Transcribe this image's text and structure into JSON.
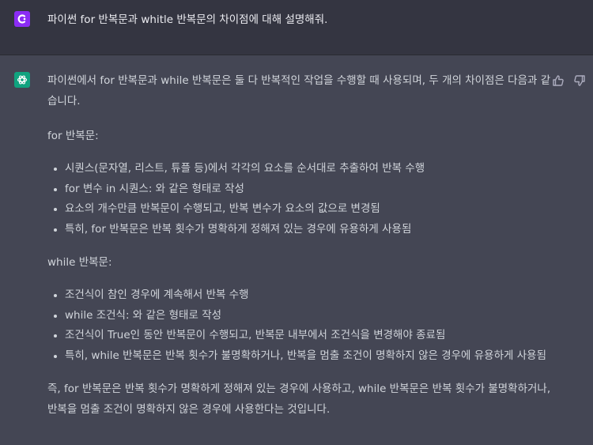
{
  "user_message": {
    "text": "파이썬 for 반복문과 whitle 반복문의 차이점에 대해 설명해줘."
  },
  "assistant_message": {
    "intro": "파이썬에서 for 반복문과 while 반복문은 둘 다 반복적인 작업을 수행할 때 사용되며, 두 개의 차이점은 다음과 같습니다.",
    "intro_line1": "파이썬에서 for 반복문과 while 반복문은 둘 다 반복적인 작업을 수행할 때 사용되며, 두 개의 차이점은 다음과 같",
    "intro_line2": "습니다.",
    "sections": [
      {
        "heading": "for 반복문:",
        "items": [
          "시퀀스(문자열, 리스트, 튜플 등)에서 각각의 요소를 순서대로 추출하여 반복 수행",
          "for 변수 in 시퀀스: 와 같은 형태로 작성",
          "요소의 개수만큼 반복문이 수행되고, 반복 변수가 요소의 값으로 변경됨",
          "특히, for 반복문은 반복 횟수가 명확하게 정해져 있는 경우에 유용하게 사용됨"
        ]
      },
      {
        "heading": "while 반복문:",
        "items": [
          "조건식이 참인 경우에 계속해서 반복 수행",
          "while 조건식: 와 같은 형태로 작성",
          "조건식이 True인 동안 반복문이 수행되고, 반복문 내부에서 조건식을 변경해야 종료됨",
          "특히, while 반복문은 반복 횟수가 불명확하거나, 반복을 멈출 조건이 명확하지 않은 경우에 유용하게 사용됨"
        ]
      }
    ],
    "conclusion_line1": "즉, for 반복문은 반복 횟수가 명확하게 정해져 있는 경우에 사용하고, while 반복문은 반복 횟수가 불명확하거나,",
    "conclusion_line2": "반복을 멈출 조건이 명확하지 않은 경우에 사용한다는 것입니다."
  },
  "icons": {
    "user_avatar": "user-avatar-icon",
    "assistant_avatar": "openai-logo-icon",
    "thumbs_up": "thumbs-up-icon",
    "thumbs_down": "thumbs-down-icon"
  },
  "colors": {
    "page_bg": "#343541",
    "assistant_bg": "#444654",
    "text": "#d1d5db",
    "user_avatar": "#8b2cf5",
    "assistant_avatar": "#10a37f"
  }
}
